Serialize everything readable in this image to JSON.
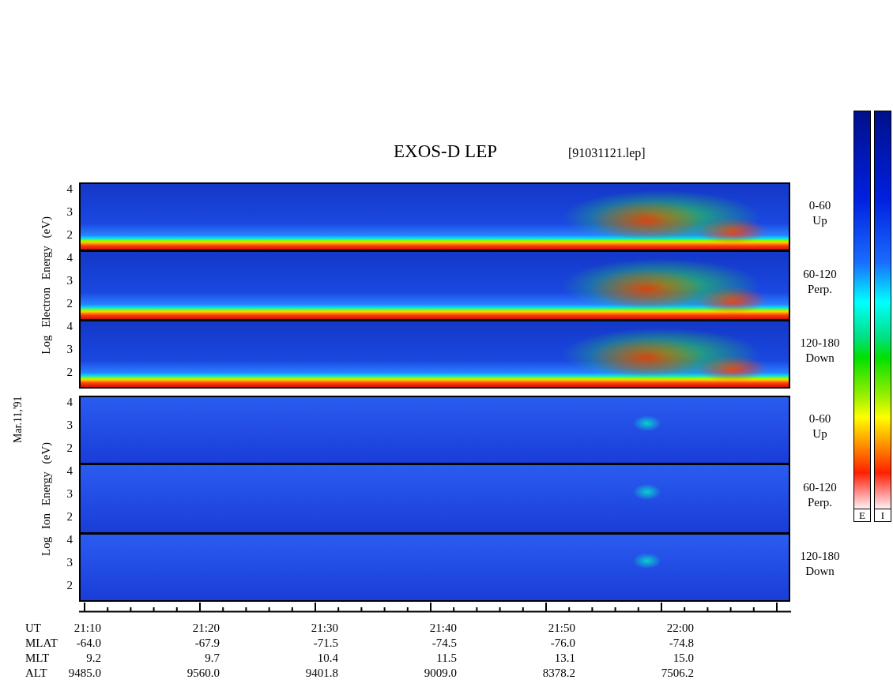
{
  "title": "EXOS-D LEP",
  "file_label": "[91031121.lep]",
  "groups": [
    {
      "kind": "electron",
      "axis_label": "Log Electron Energy (eV)",
      "panels": [
        {
          "ticks": [
            "4",
            "3",
            "2"
          ],
          "angle": "0-60",
          "direction": "Up"
        },
        {
          "ticks": [
            "4",
            "3",
            "2"
          ],
          "angle": "60-120",
          "direction": "Perp."
        },
        {
          "ticks": [
            "4",
            "3",
            "2"
          ],
          "angle": "120-180",
          "direction": "Down"
        }
      ]
    },
    {
      "kind": "ion",
      "axis_label": "Log Ion Energy (eV)",
      "date_label": "Mar.11,'91",
      "panels": [
        {
          "ticks": [
            "4",
            "3",
            "2"
          ],
          "angle": "0-60",
          "direction": "Up"
        },
        {
          "ticks": [
            "4",
            "3",
            "2"
          ],
          "angle": "60-120",
          "direction": "Perp."
        },
        {
          "ticks": [
            "4",
            "3",
            "2"
          ],
          "angle": "120-180",
          "direction": "Down"
        }
      ]
    }
  ],
  "ephemeris": [
    {
      "name": "UT",
      "values": [
        "21:10",
        "21:20",
        "21:30",
        "21:40",
        "21:50",
        "22:00"
      ]
    },
    {
      "name": "MLAT",
      "values": [
        "-64.0",
        "-67.9",
        "-71.5",
        "-74.5",
        "-76.0",
        "-74.8"
      ]
    },
    {
      "name": "MLT",
      "values": [
        "9.2",
        "9.7",
        "10.4",
        "11.5",
        "13.1",
        "15.0"
      ]
    },
    {
      "name": "ALT",
      "values": [
        "9485.0",
        "9560.0",
        "9401.8",
        "9009.0",
        "8378.2",
        "7506.2"
      ]
    }
  ],
  "colorbars": [
    {
      "label": "E"
    },
    {
      "label": "I"
    }
  ]
}
